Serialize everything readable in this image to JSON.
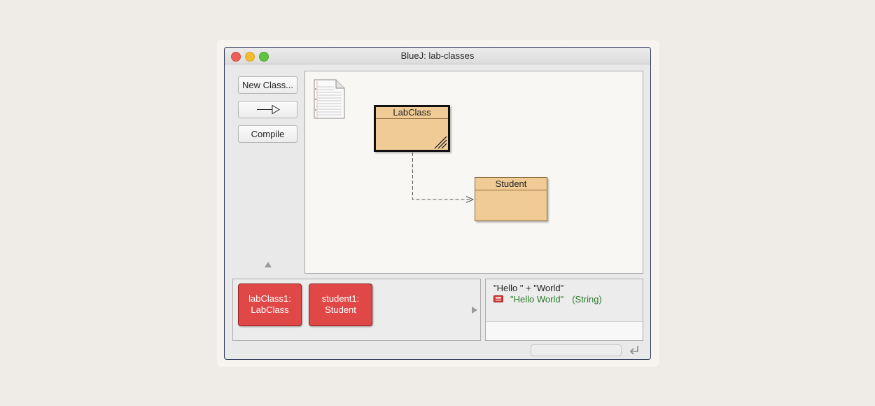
{
  "window": {
    "title": "BlueJ:  lab-classes"
  },
  "toolbar": {
    "new_class_label": "New Class...",
    "compile_label": "Compile"
  },
  "diagram": {
    "classes": [
      {
        "name": "LabClass"
      },
      {
        "name": "Student"
      }
    ]
  },
  "object_bench": {
    "objects": [
      {
        "line1": "labClass1:",
        "line2": "LabClass"
      },
      {
        "line1": "student1:",
        "line2": "Student"
      }
    ]
  },
  "codepad": {
    "expression": "\"Hello \" + \"World\"",
    "result_value": "\"Hello World\"",
    "result_type": "(String)",
    "result_color": "#2a7a2a"
  },
  "colors": {
    "class_fill": "#f1cb96",
    "object_fill": "#e04848",
    "window_border": "#2c3656"
  }
}
